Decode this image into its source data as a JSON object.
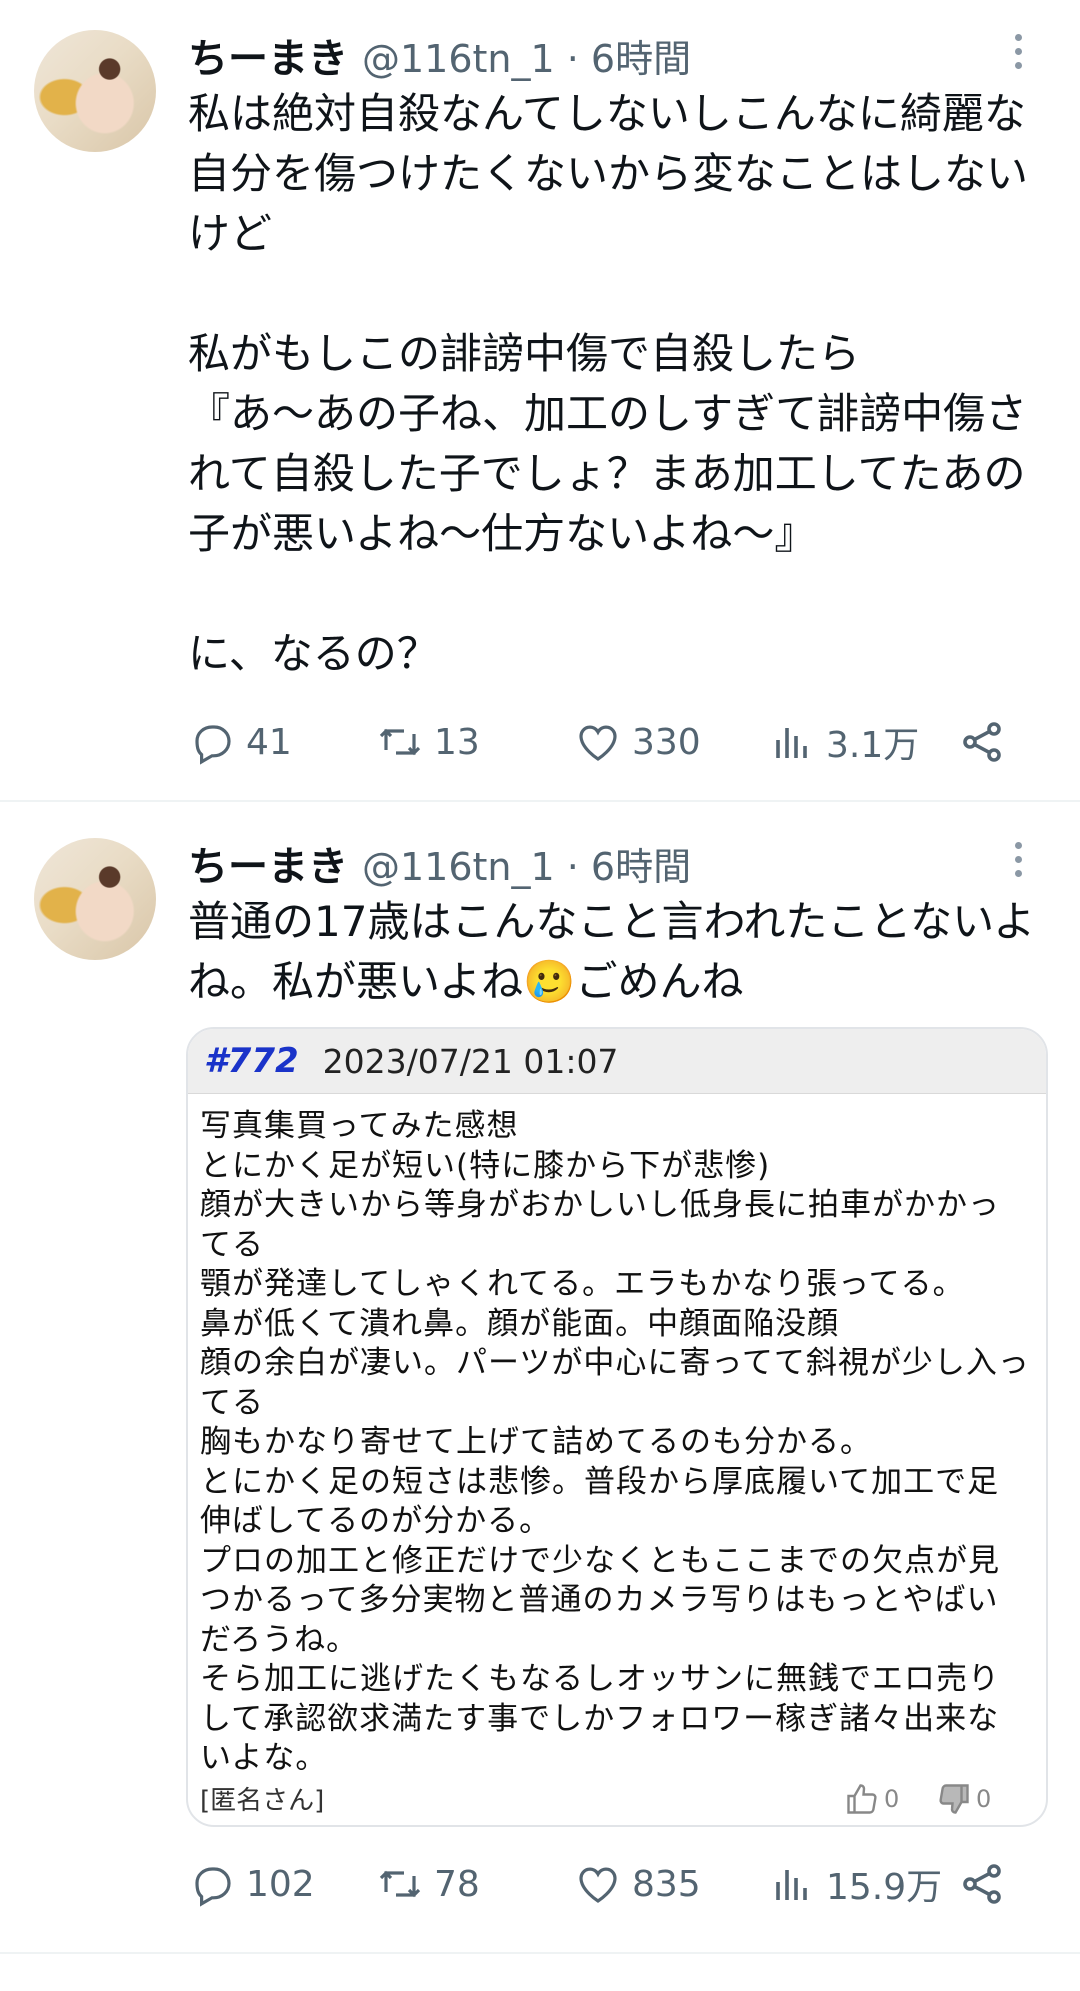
{
  "tweets": [
    {
      "user_name": "ちーまき",
      "handle_time": "@116tn_1 · 6時間",
      "text": "私は絶対自殺なんてしないしこんなに綺麗な自分を傷つけたくないから変なことはしないけど\n\n私がもしこの誹謗中傷で自殺したら\n『あ〜あの子ね、加工のしすぎて誹謗中傷されて自殺した子でしょ？まあ加工してたあの子が悪いよね〜仕方ないよね〜』\n\nに、なるの？",
      "replies": "41",
      "retweets": "13",
      "likes": "330",
      "views": "3.1万"
    },
    {
      "user_name": "ちーまき",
      "handle_time": "@116tn_1 · 6時間",
      "text": "普通の17歳はこんなこと言われたことないよね。私が悪いよね🥲ごめんね",
      "replies": "102",
      "retweets": "78",
      "likes": "835",
      "views": "15.9万"
    }
  ],
  "embedded_post": {
    "number": "#772",
    "date": "2023/07/21 01:07",
    "body": "写真集買ってみた感想\nとにかく足が短い(特に膝から下が悲惨)\n顔が大きいから等身がおかしいし低身長に拍車がかかってる\n顎が発達してしゃくれてる。エラもかなり張ってる。\n鼻が低くて潰れ鼻。顔が能面。中顔面陥没顔\n顔の余白が凄い。パーツが中心に寄ってて斜視が少し入ってる\n胸もかなり寄せて上げて詰めてるのも分かる。\nとにかく足の短さは悲惨。普段から厚底履いて加工で足伸ばしてるのが分かる。\nプロの加工と修正だけで少なくともここまでの欠点が見つかるって多分実物と普通のカメラ写りはもっとやばいだろうね。\nそら加工に逃げたくもなるしオッサンに無銭でエロ売りして承認欲求満たす事でしかフォロワー稼ぎ諸々出来ないよな。",
    "author": "[匿名さん]",
    "upvotes": "0",
    "downvotes": "0"
  },
  "icons": [
    "more-icon",
    "reply-icon",
    "retweet-icon",
    "like-icon",
    "views-icon",
    "share-icon",
    "thumbs-up-icon",
    "thumbs-down-icon"
  ],
  "colors": {
    "text": "#0f1419",
    "secondary": "#536471",
    "post_number": "#1a33c9",
    "divider": "#eff3f4"
  }
}
